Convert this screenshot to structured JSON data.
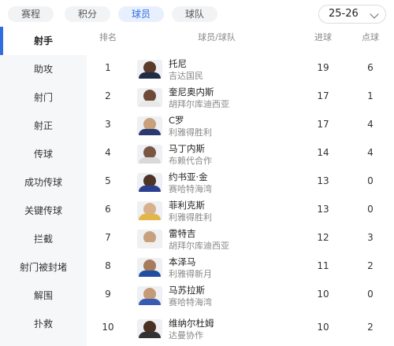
{
  "tabs": [
    {
      "label": "赛程",
      "active": false
    },
    {
      "label": "积分",
      "active": false
    },
    {
      "label": "球员",
      "active": true
    },
    {
      "label": "球队",
      "active": false
    }
  ],
  "season": {
    "label": "25-26"
  },
  "sidebar": {
    "items": [
      {
        "label": "射手",
        "active": true
      },
      {
        "label": "助攻",
        "active": false
      },
      {
        "label": "射门",
        "active": false
      },
      {
        "label": "射正",
        "active": false
      },
      {
        "label": "传球",
        "active": false
      },
      {
        "label": "成功传球",
        "active": false
      },
      {
        "label": "关键传球",
        "active": false
      },
      {
        "label": "拦截",
        "active": false
      },
      {
        "label": "射门被封堵",
        "active": false
      },
      {
        "label": "解围",
        "active": false
      },
      {
        "label": "扑救",
        "active": false
      }
    ]
  },
  "table": {
    "headers": {
      "rank": "排名",
      "player": "球员/球队",
      "goals": "进球",
      "pens": "点球"
    },
    "rows": [
      {
        "rank": "1",
        "name": "托尼",
        "team": "吉达国民",
        "goals": "19",
        "pens": "6"
      },
      {
        "rank": "2",
        "name": "奎尼奥内斯",
        "team": "胡拜尔库迪西亚",
        "goals": "17",
        "pens": "1"
      },
      {
        "rank": "3",
        "name": "C罗",
        "team": "利雅得胜利",
        "goals": "17",
        "pens": "4"
      },
      {
        "rank": "4",
        "name": "马丁内斯",
        "team": "布赖代合作",
        "goals": "14",
        "pens": "4"
      },
      {
        "rank": "5",
        "name": "约书亚·金",
        "team": "赛哈特海湾",
        "goals": "13",
        "pens": "0"
      },
      {
        "rank": "6",
        "name": "菲利克斯",
        "team": "利雅得胜利",
        "goals": "13",
        "pens": "0"
      },
      {
        "rank": "7",
        "name": "雷特吉",
        "team": "胡拜尔库迪西亚",
        "goals": "12",
        "pens": "3"
      },
      {
        "rank": "8",
        "name": "本泽马",
        "team": "利雅得新月",
        "goals": "11",
        "pens": "2"
      },
      {
        "rank": "9",
        "name": "马苏拉斯",
        "team": "赛哈特海湾",
        "goals": "10",
        "pens": "0"
      },
      {
        "rank": "10",
        "name": "维纳尔杜姆",
        "team": "达曼协作",
        "goals": "10",
        "pens": "2"
      }
    ]
  },
  "colors": {
    "accent": "#2f6de0",
    "sidebar_bg": "#f6f7f9",
    "muted": "#888888"
  },
  "icons": {
    "season_dropdown": "chevron-down-icon",
    "player_photo": "avatar"
  }
}
